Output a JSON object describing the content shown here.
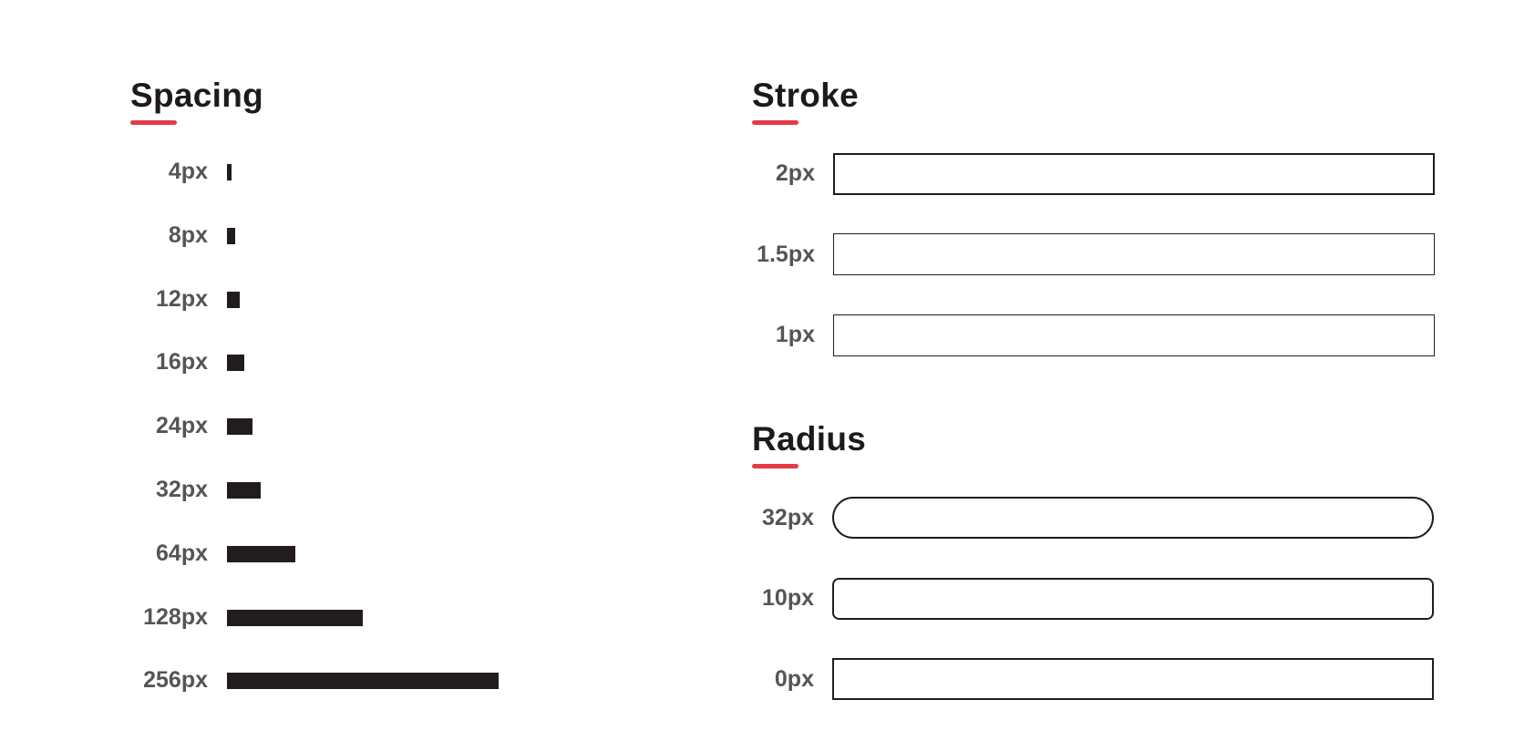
{
  "colors": {
    "accent": "#e43a45",
    "ink": "#221c1e",
    "label": "#555555"
  },
  "spacing": {
    "title": "Spacing",
    "items": [
      {
        "label": "4px",
        "value": 4
      },
      {
        "label": "8px",
        "value": 8
      },
      {
        "label": "12px",
        "value": 12
      },
      {
        "label": "16px",
        "value": 16
      },
      {
        "label": "24px",
        "value": 24
      },
      {
        "label": "32px",
        "value": 32
      },
      {
        "label": "64px",
        "value": 64
      },
      {
        "label": "128px",
        "value": 128
      },
      {
        "label": "256px",
        "value": 256
      }
    ]
  },
  "stroke": {
    "title": "Stroke",
    "items": [
      {
        "label": "2px",
        "value": 2
      },
      {
        "label": "1.5px",
        "value": 1.5
      },
      {
        "label": "1px",
        "value": 1
      }
    ]
  },
  "radius": {
    "title": "Radius",
    "items": [
      {
        "label": "32px",
        "value": 32
      },
      {
        "label": "10px",
        "value": 10
      },
      {
        "label": "0px",
        "value": 0
      }
    ]
  }
}
